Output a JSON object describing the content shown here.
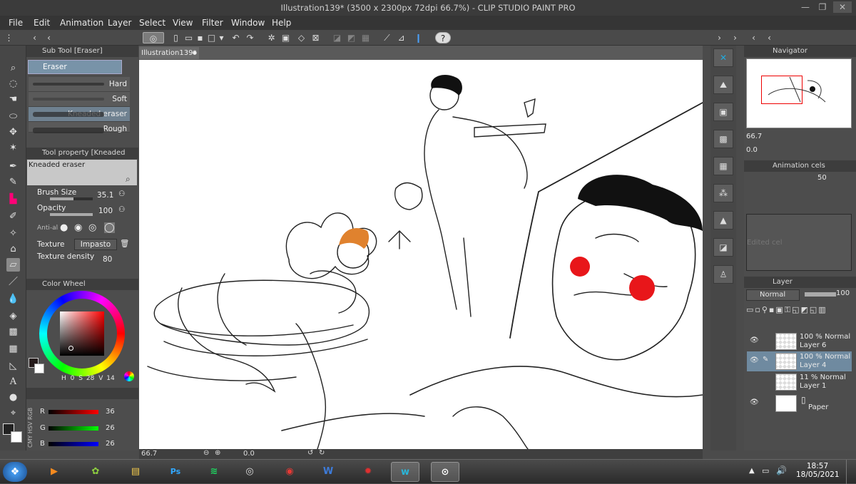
{
  "window": {
    "title": "Illustration139* (3500 x 2300px 72dpi 66.7%) - CLIP STUDIO PAINT PRO",
    "minimize": "—",
    "maximize": "❐",
    "close": "✕"
  },
  "menu": [
    "File",
    "Edit",
    "Animation",
    "Layer",
    "Select",
    "View",
    "Filter",
    "Window",
    "Help"
  ],
  "document_tab": {
    "label": "Illustration139*",
    "close": "●"
  },
  "sub_tool": {
    "title": "Sub Tool [Eraser]",
    "group": "Eraser",
    "brushes": [
      "Hard",
      "Soft",
      "Kneaded eraser",
      "Rough"
    ],
    "selected": "Kneaded eraser"
  },
  "tool_property": {
    "title": "Tool property [Kneaded erase",
    "preview_label": "Kneaded eraser",
    "brush_size_label": "Brush Size",
    "brush_size": "35.1",
    "opacity_label": "Opacity",
    "opacity": "100",
    "opacity_fraction": 1.0,
    "brush_size_fraction": 0.55,
    "antialias_label": "Anti-al",
    "texture_label": "Texture",
    "texture_value": "Impasto",
    "texture_density_label": "Texture density",
    "texture_density": "80"
  },
  "color_wheel": {
    "title": "Color Wheel",
    "h_label": "H",
    "h": "0",
    "s_label": "S",
    "s": "28",
    "v_label": "V",
    "v": "14"
  },
  "color_slider": {
    "side_tabs": [
      "RGB",
      "HSV",
      "CMY"
    ],
    "r_label": "R",
    "r": "36",
    "g_label": "G",
    "g": "26",
    "b_label": "B",
    "b": "26",
    "current_color": "#241a1a"
  },
  "navigator": {
    "title": "Navigator",
    "zoom": "66.7",
    "rotation": "0.0"
  },
  "animation_cels": {
    "title": "Animation cels",
    "value": "50",
    "placeholder": "Edited cel"
  },
  "layer_panel": {
    "title": "Layer",
    "blend_mode": "Normal",
    "opacity": "100",
    "layers": [
      {
        "mode": "100 % Normal",
        "name": "Layer 6",
        "selected": false
      },
      {
        "mode": "100 % Normal",
        "name": "Layer 4",
        "selected": true
      },
      {
        "mode": "11 % Normal",
        "name": "Layer 1",
        "selected": false
      },
      {
        "mode": "",
        "name": "Paper",
        "selected": false
      }
    ]
  },
  "status": {
    "zoom": "66.7",
    "rotation": "0.0"
  },
  "taskbar": {
    "time": "18:57",
    "date": "18/05/2021",
    "start_glyph": "❖",
    "apps": [
      {
        "name": "media-player",
        "glyph": "▶"
      },
      {
        "name": "picasa",
        "glyph": "✿"
      },
      {
        "name": "file-explorer",
        "glyph": "▤"
      },
      {
        "name": "photoshop",
        "glyph": "Ps"
      },
      {
        "name": "spotify",
        "glyph": "≋"
      },
      {
        "name": "clip-studio",
        "glyph": "◎"
      },
      {
        "name": "chrome",
        "glyph": "◉"
      },
      {
        "name": "word",
        "glyph": "W"
      },
      {
        "name": "app-red",
        "glyph": "✹"
      },
      {
        "name": "app-w",
        "glyph": "w"
      },
      {
        "name": "clip-studio-paint",
        "glyph": "⊙"
      }
    ]
  },
  "colors": {
    "accent": "#6f8aa0",
    "blush": "#e8161a",
    "hair": "#e0822e"
  }
}
